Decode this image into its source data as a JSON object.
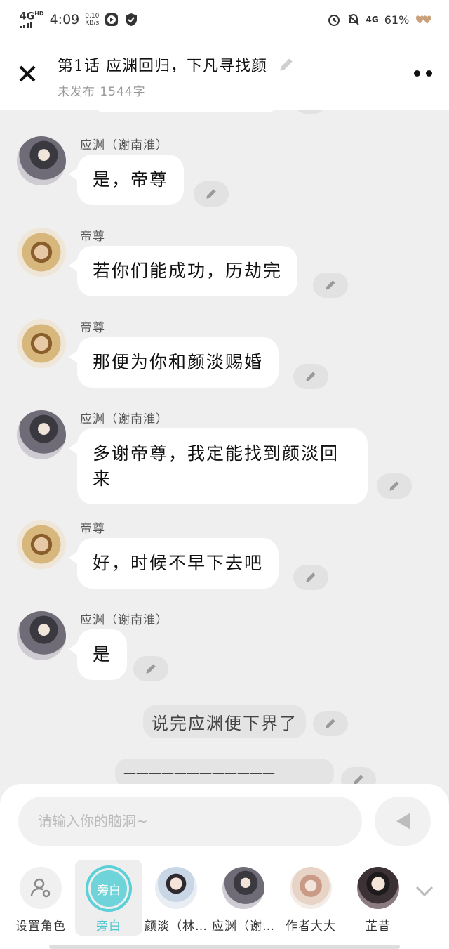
{
  "status": {
    "network": "4G",
    "network_sup": "HD",
    "time": "4:09",
    "speed_value": "0.10",
    "speed_unit": "KB/s",
    "net_right": "4G",
    "battery": "61%"
  },
  "header": {
    "title": "第1话  应渊回归，下凡寻找颜",
    "subtitle": "未发布 1544字"
  },
  "messages": [
    {
      "type": "char",
      "name": "应渊（谢南淮）",
      "text": "是，帝尊"
    },
    {
      "type": "char",
      "name": "帝尊",
      "text": "若你们能成功，历劫完"
    },
    {
      "type": "char",
      "name": "帝尊",
      "text": "那便为你和颜淡赐婚"
    },
    {
      "type": "char",
      "name": "应渊（谢南淮）",
      "text": "多谢帝尊，我定能找到颜淡回来"
    },
    {
      "type": "char",
      "name": "帝尊",
      "text": "好，时候不早下去吧"
    },
    {
      "type": "char",
      "name": "应渊（谢南淮）",
      "text": "是"
    },
    {
      "type": "narration",
      "text": "说完应渊便下界了"
    },
    {
      "type": "narration",
      "text": "————————————"
    }
  ],
  "input": {
    "placeholder": "请输入你的脑洞~"
  },
  "roles": [
    {
      "label": "设置角色",
      "icon": "person-settings-icon"
    },
    {
      "label": "旁白",
      "badge": "旁白",
      "active": true
    },
    {
      "label": "颜淡（林…"
    },
    {
      "label": "应渊（谢…"
    },
    {
      "label": "作者大大"
    },
    {
      "label": "芷昔"
    }
  ],
  "colors": {
    "accent": "#5ad0d7",
    "background": "#efefef"
  }
}
